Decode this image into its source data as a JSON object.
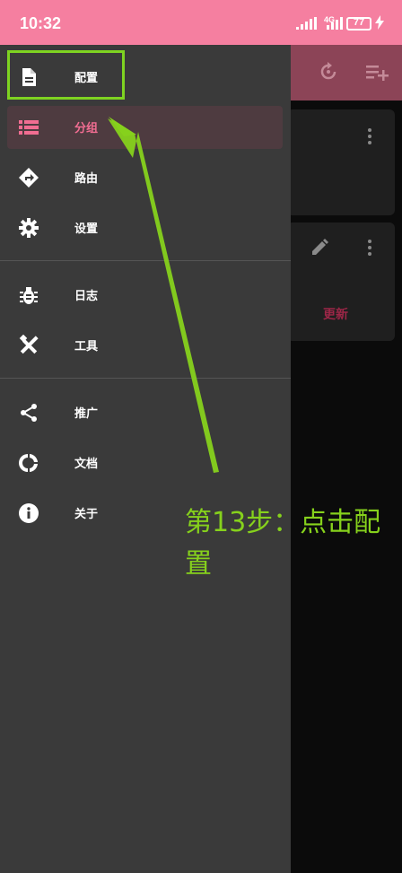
{
  "status_bar": {
    "time": "10:32",
    "network": "4G",
    "battery": "77"
  },
  "drawer": {
    "items": [
      {
        "label": "配置",
        "icon": "document-icon"
      },
      {
        "label": "分组",
        "icon": "list-icon",
        "selected": true
      },
      {
        "label": "路由",
        "icon": "route-sign-icon"
      },
      {
        "label": "设置",
        "icon": "gear-icon"
      },
      {
        "label": "日志",
        "icon": "bug-icon"
      },
      {
        "label": "工具",
        "icon": "tools-icon"
      },
      {
        "label": "推广",
        "icon": "share-icon"
      },
      {
        "label": "文档",
        "icon": "donut-icon"
      },
      {
        "label": "关于",
        "icon": "info-icon"
      }
    ]
  },
  "background": {
    "update_label": "更新"
  },
  "annotation": {
    "text": "第13步：点击配置"
  },
  "colors": {
    "status_bar": "#f57fa0",
    "drawer_bg": "#3a3a3a",
    "accent": "#f16d92",
    "annotation": "#86d11c"
  }
}
